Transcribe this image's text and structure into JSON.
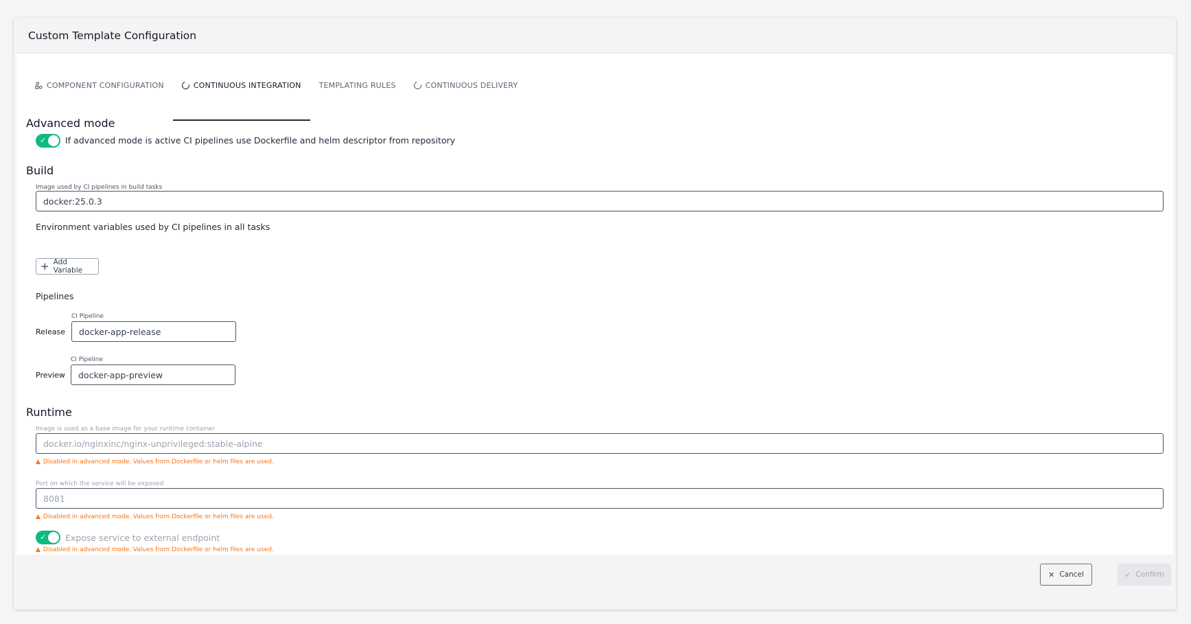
{
  "dialog": {
    "title": "Custom Template Configuration"
  },
  "tabs": [
    {
      "label": "COMPONENT CONFIGURATION",
      "icon": "component-icon"
    },
    {
      "label": "CONTINUOUS INTEGRATION",
      "icon": "circle-icon",
      "active": true
    },
    {
      "label": "TEMPLATING RULES"
    },
    {
      "label": "CONTINUOUS DELIVERY",
      "icon": "circle-icon"
    }
  ],
  "advanced": {
    "title": "Advanced mode",
    "toggle_label": "If advanced mode is active CI pipelines use Dockerfile and helm descriptor from repository"
  },
  "build": {
    "title": "Build",
    "image_label": "Image used by CI pipelines in build tasks",
    "image_value": "docker:25.0.3",
    "env_label": "Environment variables used by CI pipelines in all tasks",
    "add_variable": "Add Variable",
    "pipelines_title": "Pipelines",
    "release_label": "Release",
    "release_field_label": "CI Pipeline",
    "release_value": "docker-app-release",
    "preview_label": "Preview",
    "preview_field_label": "CI Pipeline",
    "preview_value": "docker-app-preview"
  },
  "runtime": {
    "title": "Runtime",
    "image_label": "Image is used as a base image for your runtime container",
    "image_value": "docker.io/nginxinc/nginx-unprivileged:stable-alpine",
    "warning": "Disabled in advanced mode. Values from Dockerfile or helm files are used.",
    "port_label": "Port on which the service will be exposed",
    "port_value": "8081",
    "expose_label": "Expose service to external endpoint"
  },
  "footer": {
    "cancel": "Cancel",
    "confirm": "Confirm"
  },
  "colors": {
    "toggle_on": "#10b981",
    "warning": "#f97316"
  }
}
